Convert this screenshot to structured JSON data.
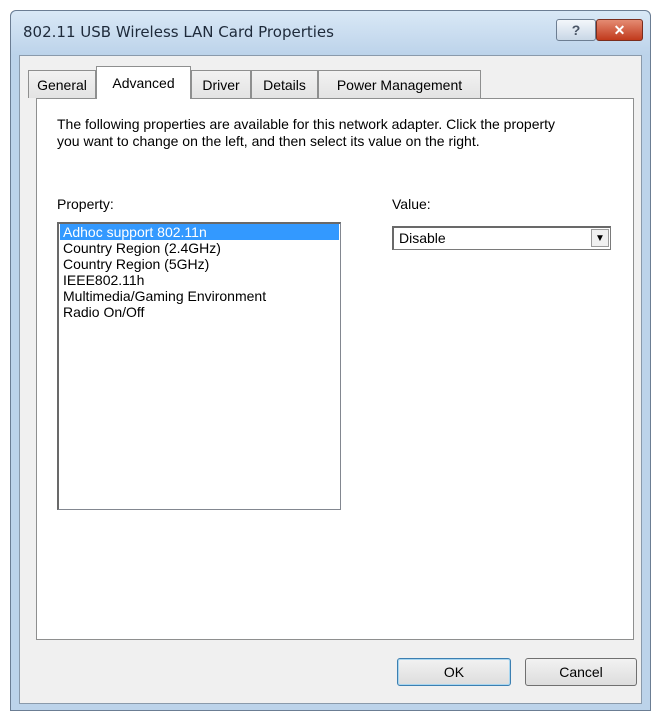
{
  "window": {
    "title": "802.11 USB Wireless LAN Card Properties",
    "help_label": "?",
    "close_label": "✕"
  },
  "tabs": [
    {
      "label": "General",
      "active": false
    },
    {
      "label": "Advanced",
      "active": true
    },
    {
      "label": "Driver",
      "active": false
    },
    {
      "label": "Details",
      "active": false
    },
    {
      "label": "Power Management",
      "active": false
    }
  ],
  "advanced": {
    "description": "The following properties are available for this network adapter. Click the property you want to change on the left, and then select its value on the right.",
    "property_label": "Property:",
    "value_label": "Value:",
    "properties": [
      "Adhoc support 802.11n",
      "Country Region (2.4GHz)",
      "Country Region (5GHz)",
      "IEEE802.11h",
      "Multimedia/Gaming Environment",
      "Radio On/Off"
    ],
    "selected_property": "Adhoc support 802.11n",
    "value": "Disable",
    "dropdown_icon": "chevron-down-icon"
  },
  "buttons": {
    "ok": "OK",
    "cancel": "Cancel"
  },
  "colors": {
    "selection": "#3399ff",
    "close_button": "#c13a1c",
    "frame": "#bcd3ea"
  }
}
